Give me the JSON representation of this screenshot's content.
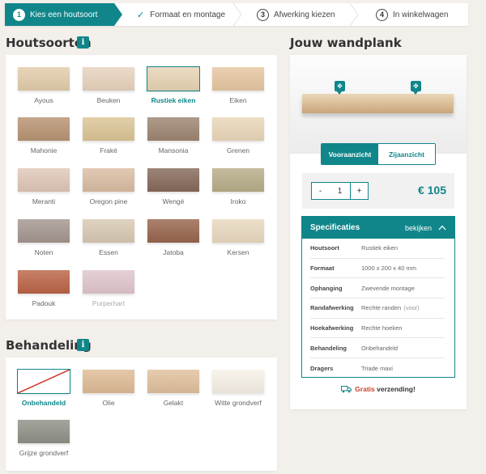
{
  "steps": [
    {
      "number": "1",
      "label": "Kies een houtsoort"
    },
    {
      "label": "Formaat en montage"
    },
    {
      "number": "3",
      "label": "Afwerking kiezen"
    },
    {
      "number": "4",
      "label": "In winkelwagen"
    }
  ],
  "woods": {
    "title": "Houtsoorten",
    "info": "i",
    "items": [
      {
        "label": "Ayous",
        "color": "#e3ccab"
      },
      {
        "label": "Beuken",
        "color": "#e8d3bd"
      },
      {
        "label": "Rustiek eiken",
        "color": "#e7d4b4"
      },
      {
        "label": "Eiken",
        "color": "#e6c7a1"
      },
      {
        "label": "Mahonie",
        "color": "#b89373"
      },
      {
        "label": "Fraké",
        "color": "#dcc596"
      },
      {
        "label": "Mansonia",
        "color": "#9d8571"
      },
      {
        "label": "Grenen",
        "color": "#ead7b8"
      },
      {
        "label": "Meranti",
        "color": "#e0c7b7"
      },
      {
        "label": "Oregon pine",
        "color": "#dabda3"
      },
      {
        "label": "Wengé",
        "color": "#86695a"
      },
      {
        "label": "Iroko",
        "color": "#b7ad88"
      },
      {
        "label": "Noten",
        "color": "#a4968f"
      },
      {
        "label": "Essen",
        "color": "#d8c9b3"
      },
      {
        "label": "Jatoba",
        "color": "#98654d"
      },
      {
        "label": "Kersen",
        "color": "#e9d9c0"
      },
      {
        "label": "Padouk",
        "color": "#bb6447"
      },
      {
        "label": "Purperhart",
        "color": "#e0c6cc"
      }
    ]
  },
  "treatment": {
    "title": "Behandeling",
    "info": "i",
    "items": [
      {
        "label": "Onbehandeld",
        "color": "#ffffff"
      },
      {
        "label": "Olie",
        "color": "#dfbc95"
      },
      {
        "label": "Gelakt",
        "color": "#e0c09d"
      },
      {
        "label": "Witte grondverf",
        "color": "#f7f1e6"
      },
      {
        "label": "Grijze grondverf",
        "color": "#8f9187"
      }
    ]
  },
  "product": {
    "title": "Jouw wandplank",
    "view_tabs": [
      "Vooraanzicht",
      "Zijaanzicht"
    ],
    "quantity": "1",
    "minus": "-",
    "plus": "+",
    "price": "€ 105"
  },
  "specs": {
    "title": "Specificaties",
    "toggle": "bekijken",
    "rows": [
      {
        "key": "Houtsoort",
        "value": "Rustiek eiken"
      },
      {
        "key": "Formaat",
        "value": "1000 x 200 x 40 mm"
      },
      {
        "key": "Ophanging",
        "value": "Zwevende montage"
      },
      {
        "key": "Randafwerking",
        "value": "Rechte randen",
        "extra": "(voor)"
      },
      {
        "key": "Hoekafwerking",
        "value": "Rechte hoeken"
      },
      {
        "key": "Behandeling",
        "value": "Onbehandeld"
      },
      {
        "key": "Dragers",
        "value": "Triade maxi"
      }
    ]
  },
  "shipping": {
    "highlight": "Gratis",
    "text": "verzending!"
  },
  "colors": {
    "accent": "#10868a",
    "price": "#10868a",
    "free": "#c9432f"
  }
}
